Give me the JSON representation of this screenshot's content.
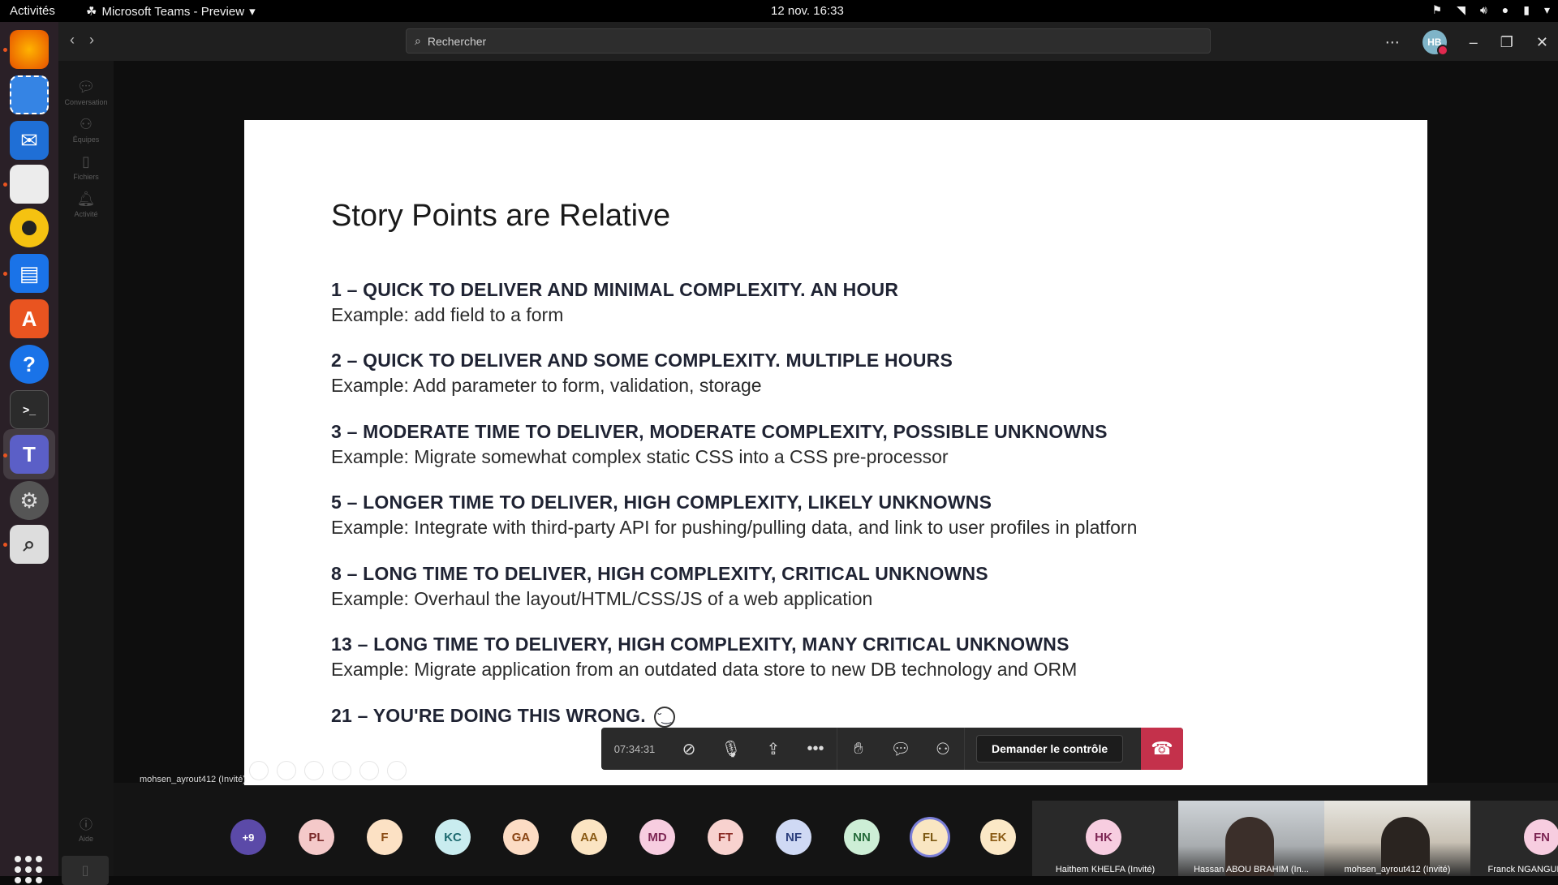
{
  "topbar": {
    "activities": "Activités",
    "app_name": "Microsoft Teams - Preview",
    "datetime": "12 nov.  16:33"
  },
  "teams": {
    "search_placeholder": "Rechercher",
    "user_initials": "HB",
    "rail": {
      "conversation": "Conversation",
      "teams": "Équipes",
      "files": "Fichiers",
      "activity": "Activité",
      "help": "Aide"
    }
  },
  "slide": {
    "title": "Story Points are Relative",
    "points": [
      {
        "head": "1 – QUICK TO DELIVER AND MINIMAL COMPLEXITY. AN HOUR",
        "example": "Example: add field to a form"
      },
      {
        "head": "2 – QUICK TO DELIVER AND SOME COMPLEXITY. MULTIPLE HOURS",
        "example": "Example: Add parameter to form, validation, storage"
      },
      {
        "head": "3 – MODERATE TIME TO DELIVER, MODERATE COMPLEXITY, POSSIBLE UNKNOWNS",
        "example": "Example: Migrate somewhat complex static CSS into a CSS pre-processor"
      },
      {
        "head": "5 – LONGER TIME TO DELIVER, HIGH COMPLEXITY, LIKELY UNKNOWNS",
        "example": "Example: Integrate with third-party API for pushing/pulling data, and link to user profiles in platforn"
      },
      {
        "head": "8 – LONG TIME TO DELIVER, HIGH COMPLEXITY, CRITICAL UNKNOWNS",
        "example": "Example: Overhaul the layout/HTML/CSS/JS of a web application"
      },
      {
        "head": "13 – LONG TIME TO DELIVERY, HIGH COMPLEXITY, MANY CRITICAL UNKNOWNS",
        "example": "Example: Migrate application from an outdated data store to new DB technology and ORM"
      },
      {
        "head": "21 – YOU'RE DOING THIS WRONG.",
        "example": ""
      }
    ]
  },
  "call": {
    "timer": "07:34:31",
    "request_control": "Demander le contrôle",
    "presenter": "mohsen_ayrout412 (Invité)"
  },
  "participants": {
    "overflow": "+9",
    "avatars": [
      {
        "initials": "PL",
        "bg": "#f4c9c9",
        "fg": "#7a2a2a"
      },
      {
        "initials": "F",
        "bg": "#fce1c4",
        "fg": "#8a4b14"
      },
      {
        "initials": "KC",
        "bg": "#c9ecef",
        "fg": "#1e6a70"
      },
      {
        "initials": "GA",
        "bg": "#fcdcc4",
        "fg": "#8a4514"
      },
      {
        "initials": "AA",
        "bg": "#fbe4c2",
        "fg": "#8a5a14"
      },
      {
        "initials": "MD",
        "bg": "#f7cde0",
        "fg": "#7d2654"
      },
      {
        "initials": "FT",
        "bg": "#f8d2cf",
        "fg": "#8a2c26"
      },
      {
        "initials": "NF",
        "bg": "#cfd9f4",
        "fg": "#2c3f7d"
      },
      {
        "initials": "NN",
        "bg": "#cdeed6",
        "fg": "#256b3a"
      },
      {
        "initials": "FL",
        "bg": "#f9e6c2",
        "fg": "#7d5a14"
      },
      {
        "initials": "EK",
        "bg": "#fbe8c6",
        "fg": "#8a5a14"
      }
    ],
    "tiles": [
      {
        "initials": "HK",
        "name": "Haithem KHELFA (Invité)"
      },
      {
        "name": "Hassan ABOU BRAHIM (In..."
      },
      {
        "name": "mohsen_ayrout412 (Invité)"
      },
      {
        "initials": "FN",
        "name": "Franck NGANGUEN (Invité)"
      }
    ]
  }
}
